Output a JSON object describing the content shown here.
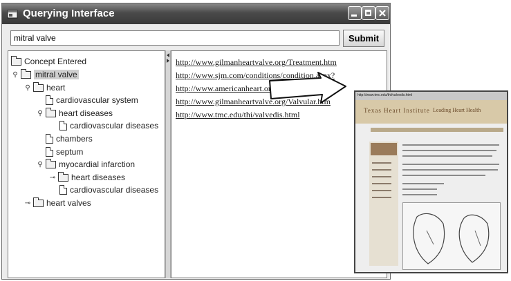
{
  "window": {
    "title": "Querying Interface"
  },
  "search": {
    "value": "mitral valve",
    "submit_label": "Submit"
  },
  "tree": {
    "root_label": "Concept Entered",
    "nodes": [
      {
        "label": "mitral valve",
        "type": "folder",
        "handle": "expanded",
        "selected": true
      },
      {
        "label": "heart",
        "type": "folder",
        "handle": "expanded"
      },
      {
        "label": "cardiovascular system",
        "type": "leaf"
      },
      {
        "label": "heart diseases",
        "type": "folder",
        "handle": "expanded"
      },
      {
        "label": "cardiovascular diseases",
        "type": "leaf"
      },
      {
        "label": "chambers",
        "type": "leaf"
      },
      {
        "label": "septum",
        "type": "leaf"
      },
      {
        "label": "myocardial infarction",
        "type": "folder",
        "handle": "expanded"
      },
      {
        "label": "heart diseases",
        "type": "folder",
        "handle": "collapsed"
      },
      {
        "label": "cardiovascular diseases",
        "type": "leaf"
      },
      {
        "label": "heart valves",
        "type": "folder",
        "handle": "collapsed"
      }
    ]
  },
  "links": [
    "http://www.gilmanheartvalve.org/Treatment.htm",
    "http://www.sjm.com/conditions/condition.aspx?",
    "http://www.americanheart.org/presenter.jhtml?",
    "http://www.gilmanheartvalve.org/Valvular.htm",
    "http://www.tmc.edu/thi/valvedis.html"
  ],
  "preview": {
    "site_title": "Texas Heart Institute",
    "tagline": "Leading Heart Health"
  },
  "icons": {
    "app": "app-window-icon",
    "minimize": "minimize-icon",
    "maximize": "maximize-icon",
    "close": "close-icon",
    "folder": "folder-icon",
    "document": "document-icon",
    "arrow": "right-arrow-icon"
  },
  "colors": {
    "titlebar": "#4a4a4a",
    "pane_bg": "#ffffff",
    "selection": "#cfcfcf"
  }
}
